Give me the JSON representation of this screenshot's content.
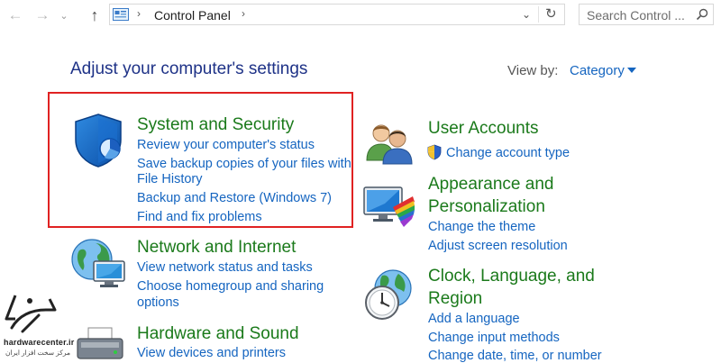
{
  "toolbar": {
    "back_icon": "back-arrow-icon",
    "forward_icon": "forward-arrow-icon",
    "up_icon": "up-arrow-icon",
    "address_path": "Control Panel",
    "search_placeholder": "Search Control ..."
  },
  "header": {
    "title": "Adjust your computer's settings",
    "view_by_label": "View by:",
    "view_by_value": "Category"
  },
  "categories": {
    "system_security": {
      "title": "System and Security",
      "links": [
        "Review your computer's status",
        "Save backup copies of your files with",
        "File History",
        "Backup and Restore (Windows 7)",
        "Find and fix problems"
      ]
    },
    "network": {
      "title": "Network and Internet",
      "links": [
        "View network status and tasks",
        "Choose homegroup and sharing",
        "options"
      ]
    },
    "hardware": {
      "title": "Hardware and Sound",
      "links": [
        "View devices and printers"
      ]
    },
    "user_accounts": {
      "title": "User Accounts",
      "links": [
        "Change account type"
      ]
    },
    "appearance": {
      "title_line1": "Appearance and",
      "title_line2": "Personalization",
      "links": [
        "Change the theme",
        "Adjust screen resolution"
      ]
    },
    "clock": {
      "title_line1": "Clock, Language, and",
      "title_line2": "Region",
      "links": [
        "Add a language",
        "Change input methods",
        "Change date, time, or number"
      ]
    }
  },
  "watermark": {
    "site": "hardwarecenter.ir",
    "tagline": "مرکز سخت افزار ایران"
  },
  "colors": {
    "title_blue": "#1e3287",
    "category_green": "#1b7a1b",
    "link_blue": "#1565c0",
    "highlight_red": "#e02222"
  }
}
